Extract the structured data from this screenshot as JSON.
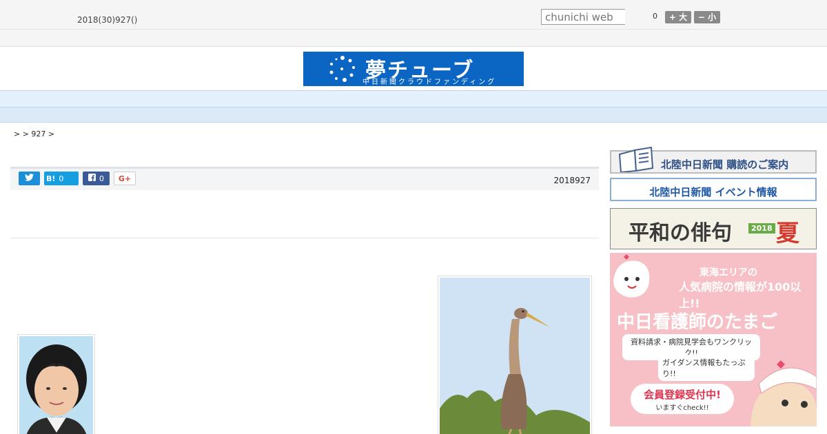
{
  "header": {
    "date": "2018(30)927()",
    "search_placeholder": "chunichi web",
    "font_size_value": "0",
    "font_bigger": "+ 大",
    "font_smaller": "− 小"
  },
  "logo": {
    "title": "夢チューブ",
    "subtitle": "中日新聞クラウドファンディング",
    "color": "#0b66c3"
  },
  "nav": {
    "items": [
      "",
      "",
      "",
      "",
      "",
      "",
      "",
      "",
      ""
    ]
  },
  "breadcrumb": ">  > 927 >",
  "article": {
    "date": "2018927",
    "share": {
      "hatena_label": "B!",
      "hatena_count": "0",
      "facebook_count": "0",
      "google_label": "G+"
    }
  },
  "sidebar": {
    "ad1": "北陸中日新聞 購読のご案内",
    "ad2": "北陸中日新聞 イベント情報",
    "ad3": {
      "title": "平和の俳句",
      "year": "2018",
      "season": "夏"
    },
    "ad4": {
      "line1": "東海エリアの",
      "line2": "人気病院の情報が100以上!!",
      "title": "中日看護師のたまご",
      "line3": "資料請求・病院見学会もワンクリック!!",
      "line4": "ガイダンス情報もたっぷり!!",
      "cta": "会員登録受付中!",
      "cta_sub": "いますぐcheck!!"
    }
  }
}
